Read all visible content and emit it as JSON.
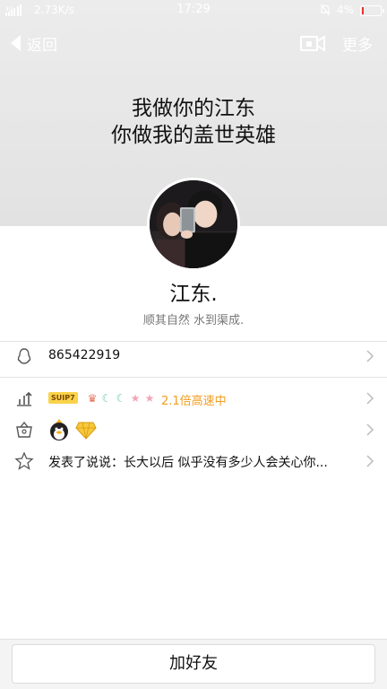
{
  "status_bar": {
    "network": "4G",
    "speed": "2.73K/s",
    "time": "17:29",
    "battery_percent": "4%",
    "battery_level": 0.04
  },
  "nav": {
    "back_label": "返回",
    "more_label": "更多"
  },
  "profile": {
    "signature_line1": "我做你的江东",
    "signature_line2": "你做我的盖世英雄",
    "nickname": "江东.",
    "bio": "顺其自然 水到渠成."
  },
  "info_rows": {
    "qq_number": "865422919",
    "vip_badge": "SUIP7",
    "speed_text": "2.1倍高速中",
    "status_post": "发表了说说：长大以后 似乎没有多少人会关心你..."
  },
  "actions": {
    "add_friend_label": "加好友"
  },
  "colors": {
    "speed_text": "#f29c1f",
    "vip_badge_bg": "#f9d34a"
  }
}
